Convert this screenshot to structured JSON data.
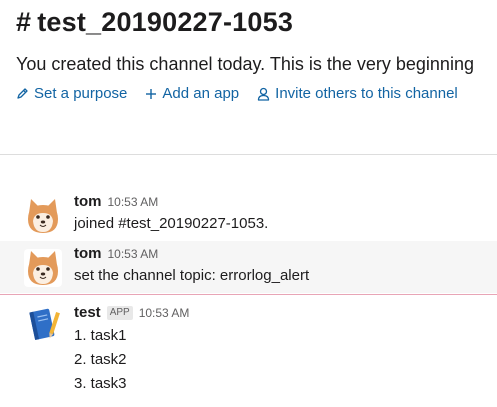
{
  "channel": {
    "hash": "#",
    "name": "test_20190227-1053",
    "intro": "You created this channel today. This is the very beginning"
  },
  "actions": {
    "set_purpose": "Set a purpose",
    "add_app": "Add an app",
    "invite": "Invite others to this channel"
  },
  "messages": [
    {
      "sender": "tom",
      "time": "10:53 AM",
      "text": "joined #test_20190227-1053."
    },
    {
      "sender": "tom",
      "time": "10:53 AM",
      "text": "set the channel topic: errorlog_alert"
    },
    {
      "sender": "test",
      "badge": "APP",
      "time": "10:53 AM",
      "lines": [
        "1. task1",
        "2. task2",
        "3. task3"
      ]
    }
  ],
  "colors": {
    "link": "#1264a3",
    "new_divider": "#e8a5b6",
    "hover_bg": "#f6f6f6"
  }
}
